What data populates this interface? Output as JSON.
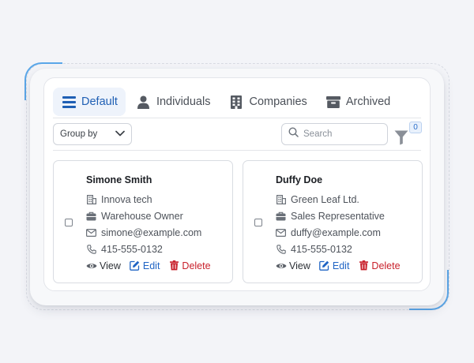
{
  "tabs": [
    {
      "label": "Default",
      "icon": "list-icon",
      "active": true
    },
    {
      "label": "Individuals",
      "icon": "person-icon",
      "active": false
    },
    {
      "label": "Companies",
      "icon": "building-icon",
      "active": false
    },
    {
      "label": "Archived",
      "icon": "archive-box-icon",
      "active": false
    }
  ],
  "toolbar": {
    "group_by_label": "Group by",
    "search_placeholder": "Search",
    "filter_count": "0"
  },
  "contacts": [
    {
      "name": "Simone Smith",
      "company": "Innova tech",
      "role": "Warehouse Owner",
      "email": "simone@example.com",
      "phone": "415-555-0132"
    },
    {
      "name": "Duffy Doe",
      "company": "Green Leaf Ltd.",
      "role": "Sales Representative",
      "email": "duffy@example.com",
      "phone": "415-555-0132"
    }
  ],
  "actions": {
    "view": "View",
    "edit": "Edit",
    "delete": "Delete"
  },
  "colors": {
    "accent": "#1f5fb4",
    "edit": "#1f64c4",
    "delete": "#c81f2a",
    "frame_accent": "#5aa6e8"
  }
}
